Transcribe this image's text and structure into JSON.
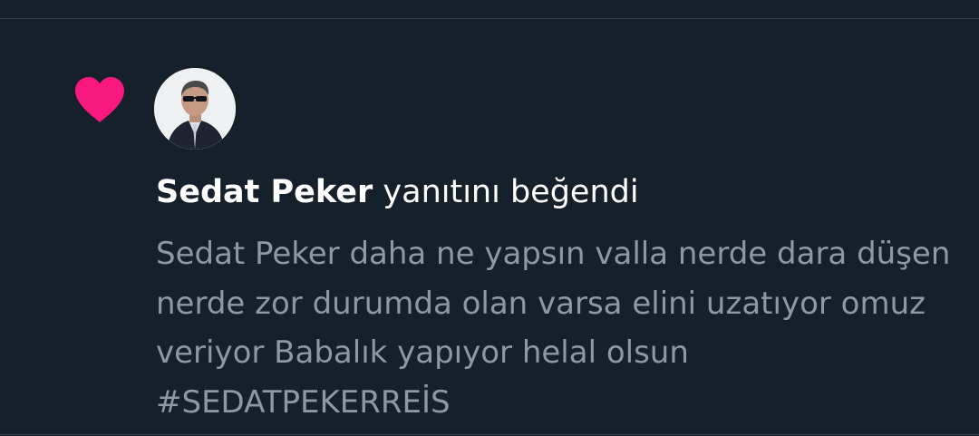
{
  "notification": {
    "type_icon": "heart-icon",
    "heart_color": "#f91880",
    "avatar_icon": "profile-photo",
    "author_name": "Sedat Peker",
    "action_text": "yanıtını beğendi",
    "reply_text": "Sedat Peker daha ne yapsın valla nerde dara düşen nerde zor durumda olan varsa elini uzatıyor omuz veriyor Babalık yapıyor helal olsun #SEDATPEKERREİS"
  },
  "colors": {
    "background": "#15202b",
    "primary_text": "#ffffff",
    "secondary_text": "#8b98a5",
    "divider": "#38444d"
  }
}
